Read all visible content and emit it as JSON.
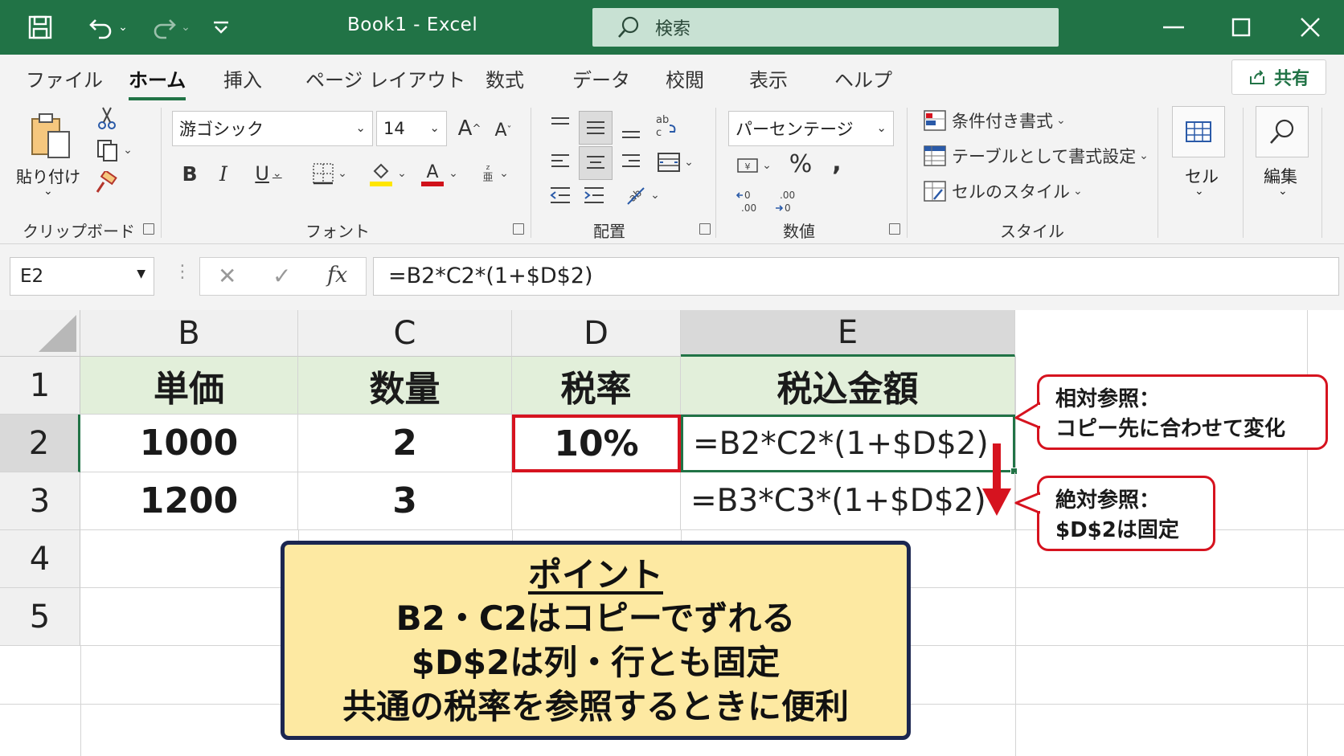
{
  "window": {
    "title": "Book1  -  Excel",
    "search_label": "検索"
  },
  "tabs": [
    "ファイル",
    "ホーム",
    "挿入",
    "ページ レイアウト",
    "数式",
    "データ",
    "校閲",
    "表示",
    "ヘルプ"
  ],
  "active_tab": "ホーム",
  "share_label": "共有",
  "ribbon": {
    "clipboard": {
      "paste_label": "貼り付け",
      "group_label": "クリップボード"
    },
    "font": {
      "font_name": "游ゴシック",
      "font_size": "14",
      "group_label": "フォント"
    },
    "alignment": {
      "group_label": "配置"
    },
    "number": {
      "format": "パーセンテージ",
      "group_label": "数値"
    },
    "styles": {
      "conditional": "条件付き書式",
      "table": "テーブルとして書式設定",
      "cell_styles": "セルのスタイル",
      "group_label": "スタイル"
    },
    "cells_label": "セル",
    "edit_label": "編集"
  },
  "formula_bar": {
    "name_box": "E2",
    "fx": "fx",
    "formula": "=B2*C2*(1+$D$2)"
  },
  "grid": {
    "columns": [
      "B",
      "C",
      "D",
      "E"
    ],
    "rows": [
      "1",
      "2",
      "3",
      "4",
      "5"
    ],
    "headers": [
      "単価",
      "数量",
      "税率",
      "税込金額"
    ],
    "row2": [
      "1000",
      "2",
      "10%",
      "=B2*C2*(1+$D$2)"
    ],
    "row3": [
      "1200",
      "3",
      "",
      "=B3*C3*(1+$D$2)"
    ]
  },
  "callouts": {
    "relative": {
      "line1": "相対参照：",
      "line2": "コピー先に合わせて変化"
    },
    "absolute": {
      "line1": "絶対参照：",
      "line2": "$D$2は固定"
    }
  },
  "point_box": {
    "title": "ポイント",
    "lines": [
      "B2・C2はコピーでずれる",
      "$D$2は列・行とも固定",
      "共通の税率を参照するときに便利"
    ]
  },
  "colors": {
    "excel_green": "#217346",
    "header_fill": "#e2efda",
    "accent_red": "#d6131f",
    "point_fill": "#fde9a2",
    "point_border": "#1b2650"
  }
}
